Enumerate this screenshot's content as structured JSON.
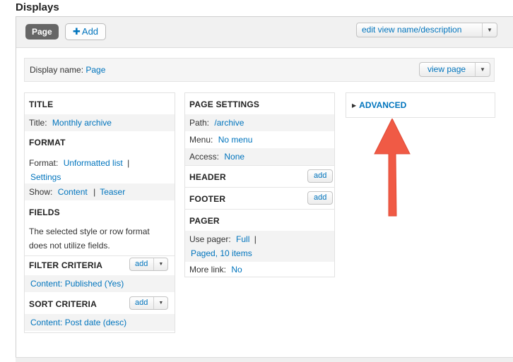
{
  "heading": "Displays",
  "topbar": {
    "tab_page": "Page",
    "add_label": "Add",
    "edit_view_label": "edit view name/description"
  },
  "display_name": {
    "label": "Display name:",
    "value": "Page",
    "view_page_label": "view page"
  },
  "col1": {
    "title_header": "TITLE",
    "title_label": "Title:",
    "title_value": "Monthly archive",
    "format_header": "FORMAT",
    "format_label": "Format:",
    "format_value": "Unformatted list",
    "format_sep": "|",
    "format_settings": "Settings",
    "show_label": "Show:",
    "show_value": "Content",
    "show_sep": "|",
    "show_teaser": "Teaser",
    "fields_header": "FIELDS",
    "fields_text": "The selected style or row format does not utilize fields.",
    "filter_header": "FILTER CRITERIA",
    "filter_add": "add",
    "filter_item": "Content: Published (Yes)",
    "sort_header": "SORT CRITERIA",
    "sort_add": "add",
    "sort_item": "Content: Post date (desc)"
  },
  "col2": {
    "page_settings_header": "PAGE SETTINGS",
    "path_label": "Path:",
    "path_value": "/archive",
    "menu_label": "Menu:",
    "menu_value": "No menu",
    "access_label": "Access:",
    "access_value": "None",
    "header_header": "HEADER",
    "header_add": "add",
    "footer_header": "FOOTER",
    "footer_add": "add",
    "pager_header": "PAGER",
    "use_pager_label": "Use pager:",
    "use_pager_value": "Full",
    "use_pager_sep": "|",
    "use_pager_paged": "Paged, 10 items",
    "more_link_label": "More link:",
    "more_link_value": "No"
  },
  "col3": {
    "advanced_label": "ADVANCED"
  },
  "colors": {
    "link": "#0074bd",
    "arrow": "#f05a45"
  },
  "icons": [
    "plus-icon",
    "caret-down-icon",
    "triangle-right-icon",
    "arrow-up-icon"
  ]
}
